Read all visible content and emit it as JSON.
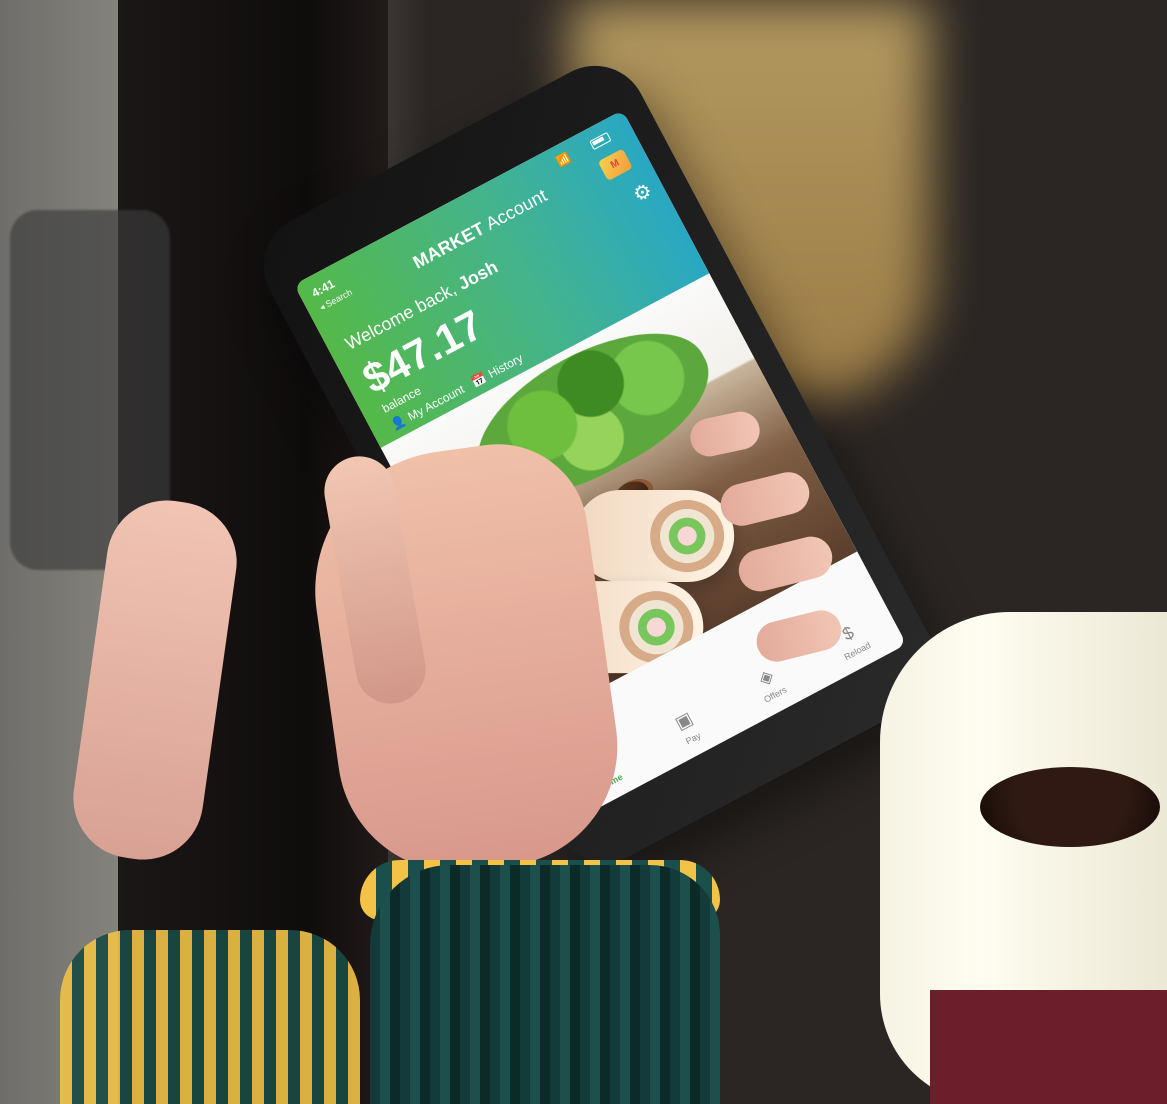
{
  "app": {
    "status_time": "4:41",
    "back_label": "◂ Search",
    "title_bold": "MARKET",
    "title_light": " Account",
    "welcome_prefix": "Welcome back, ",
    "user_name": "Josh",
    "balance_amount": "$47.17",
    "balance_label": "balance",
    "my_account_label": "My Account",
    "history_label": "History",
    "tabs": [
      {
        "label": "Home",
        "icon": "home-icon"
      },
      {
        "label": "Pay",
        "icon": "wallet-icon"
      },
      {
        "label": "Offers",
        "icon": "tag-icon"
      },
      {
        "label": "Reload",
        "icon": "dollar-icon"
      }
    ]
  },
  "colors": {
    "header_start": "#55b948",
    "header_end": "#29a8c3",
    "active_tab": "#4caf50"
  }
}
